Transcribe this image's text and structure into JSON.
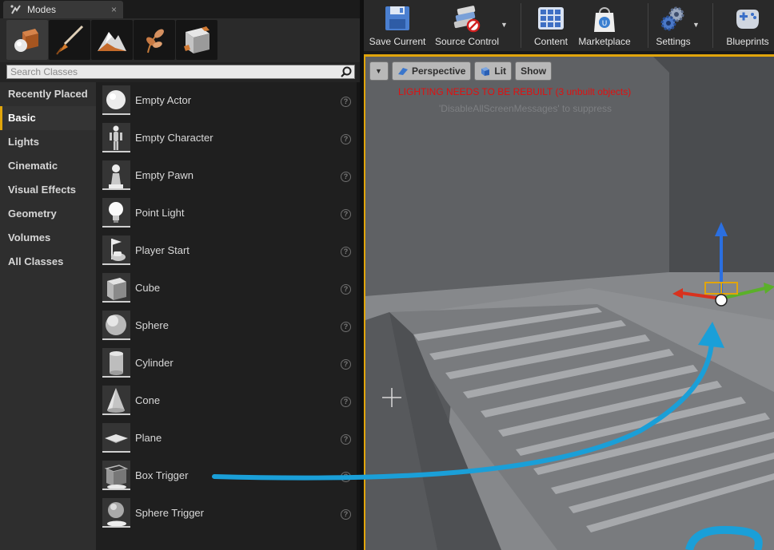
{
  "modes_panel": {
    "tab_title": "Modes",
    "close_glyph": "×",
    "mode_buttons": [
      {
        "icon": "place-mode-icon",
        "active": true
      },
      {
        "icon": "paint-mode-icon",
        "active": false
      },
      {
        "icon": "landscape-mode-icon",
        "active": false
      },
      {
        "icon": "foliage-mode-icon",
        "active": false
      },
      {
        "icon": "geometry-mode-icon",
        "active": false
      }
    ],
    "search": {
      "placeholder": "Search Classes",
      "value": ""
    },
    "categories": [
      {
        "label": "Recently Placed",
        "active": false
      },
      {
        "label": "Basic",
        "active": true
      },
      {
        "label": "Lights",
        "active": false
      },
      {
        "label": "Cinematic",
        "active": false
      },
      {
        "label": "Visual Effects",
        "active": false
      },
      {
        "label": "Geometry",
        "active": false
      },
      {
        "label": "Volumes",
        "active": false
      },
      {
        "label": "All Classes",
        "active": false
      }
    ],
    "items": [
      {
        "label": "Empty Actor",
        "icon": "empty-actor-icon"
      },
      {
        "label": "Empty Character",
        "icon": "empty-character-icon"
      },
      {
        "label": "Empty Pawn",
        "icon": "empty-pawn-icon"
      },
      {
        "label": "Point Light",
        "icon": "point-light-icon"
      },
      {
        "label": "Player Start",
        "icon": "player-start-icon"
      },
      {
        "label": "Cube",
        "icon": "cube-icon"
      },
      {
        "label": "Sphere",
        "icon": "sphere-icon"
      },
      {
        "label": "Cylinder",
        "icon": "cylinder-icon"
      },
      {
        "label": "Cone",
        "icon": "cone-icon"
      },
      {
        "label": "Plane",
        "icon": "plane-icon"
      },
      {
        "label": "Box Trigger",
        "icon": "box-trigger-icon"
      },
      {
        "label": "Sphere Trigger",
        "icon": "sphere-trigger-icon"
      }
    ],
    "help_glyph": "?"
  },
  "toolbar": {
    "buttons": [
      {
        "label": "Save Current",
        "icon": "save-icon"
      },
      {
        "label": "Source Control",
        "icon": "source-control-icon"
      },
      {
        "label": "Content",
        "icon": "content-browser-icon"
      },
      {
        "label": "Marketplace",
        "icon": "marketplace-icon"
      },
      {
        "label": "Settings",
        "icon": "settings-icon"
      },
      {
        "label": "Blueprints",
        "icon": "blueprints-icon"
      }
    ],
    "dropdown_glyph": "▼"
  },
  "viewport": {
    "menu_glyph": "▼",
    "view_mode": "Perspective",
    "lighting_mode": "Lit",
    "show_label": "Show",
    "warning": "LIGHTING NEEDS TO BE REBUILT (3 unbuilt objects)",
    "hint": "'DisableAllScreenMessages' to suppress"
  },
  "colors": {
    "accent": "#e1a50b",
    "warning": "#e01010",
    "drag_arrow": "#1a9fd8",
    "gizmo_x": "#d8321e",
    "gizmo_y": "#5bb02a",
    "gizmo_z": "#2b6fe0"
  }
}
